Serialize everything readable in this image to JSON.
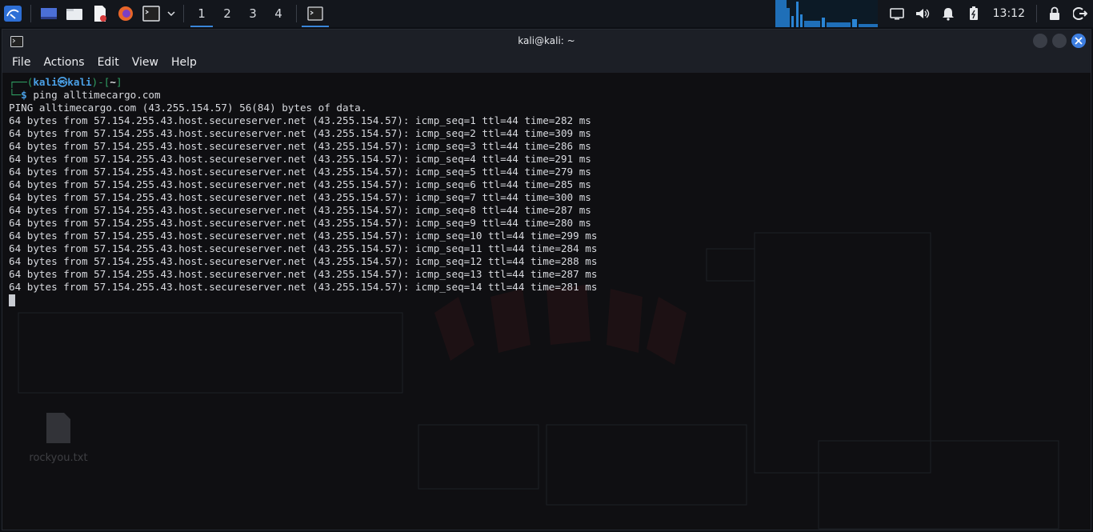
{
  "taskbar": {
    "workspaces": [
      "1",
      "2",
      "3",
      "4"
    ],
    "clock": "13:12"
  },
  "window": {
    "title": "kali@kali: ~",
    "menu": [
      "File",
      "Actions",
      "Edit",
      "View",
      "Help"
    ]
  },
  "terminal": {
    "prompt_user": "kali",
    "prompt_at": "㉿",
    "prompt_host": "kali",
    "prompt_dir": "~",
    "command": "ping alltimecargo.com",
    "lines": [
      "PING alltimecargo.com (43.255.154.57) 56(84) bytes of data.",
      "64 bytes from 57.154.255.43.host.secureserver.net (43.255.154.57): icmp_seq=1 ttl=44 time=282 ms",
      "64 bytes from 57.154.255.43.host.secureserver.net (43.255.154.57): icmp_seq=2 ttl=44 time=309 ms",
      "64 bytes from 57.154.255.43.host.secureserver.net (43.255.154.57): icmp_seq=3 ttl=44 time=286 ms",
      "64 bytes from 57.154.255.43.host.secureserver.net (43.255.154.57): icmp_seq=4 ttl=44 time=291 ms",
      "64 bytes from 57.154.255.43.host.secureserver.net (43.255.154.57): icmp_seq=5 ttl=44 time=279 ms",
      "64 bytes from 57.154.255.43.host.secureserver.net (43.255.154.57): icmp_seq=6 ttl=44 time=285 ms",
      "64 bytes from 57.154.255.43.host.secureserver.net (43.255.154.57): icmp_seq=7 ttl=44 time=300 ms",
      "64 bytes from 57.154.255.43.host.secureserver.net (43.255.154.57): icmp_seq=8 ttl=44 time=287 ms",
      "64 bytes from 57.154.255.43.host.secureserver.net (43.255.154.57): icmp_seq=9 ttl=44 time=280 ms",
      "64 bytes from 57.154.255.43.host.secureserver.net (43.255.154.57): icmp_seq=10 ttl=44 time=299 ms",
      "64 bytes from 57.154.255.43.host.secureserver.net (43.255.154.57): icmp_seq=11 ttl=44 time=284 ms",
      "64 bytes from 57.154.255.43.host.secureserver.net (43.255.154.57): icmp_seq=12 ttl=44 time=288 ms",
      "64 bytes from 57.154.255.43.host.secureserver.net (43.255.154.57): icmp_seq=13 ttl=44 time=287 ms",
      "64 bytes from 57.154.255.43.host.secureserver.net (43.255.154.57): icmp_seq=14 ttl=44 time=281 ms"
    ]
  },
  "desktop": {
    "file_label": "rockyou.txt"
  },
  "colors": {
    "accent": "#3a86d9",
    "prompt_green": "#2f9f63",
    "prompt_blue": "#4aa0e6"
  }
}
